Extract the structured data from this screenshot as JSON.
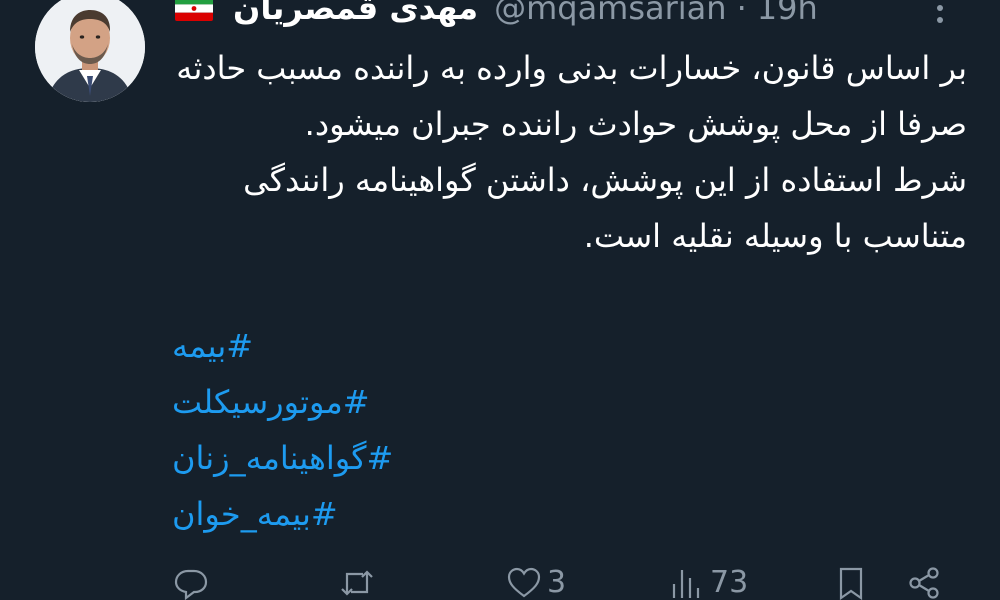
{
  "tweet": {
    "author": {
      "display_name": "مهدی قمصریان",
      "handle": "@mqamsarian",
      "separator": "·",
      "time": "19h",
      "flag_icon": "iran-flag-icon"
    },
    "body": [
      "بر اساس قانون، خسارات بدنی وارده به راننده مسبب حادثه صرفا از محل پوشش حوادث راننده جبران میشود.",
      "شرط استفاده از این پوشش، داشتن گواهینامه رانندگی متناسب با وسیله نقلیه است."
    ],
    "hashtags": [
      "#بیمه",
      "#موتورسیکلت",
      "#گواهینامه_زنان",
      "#بیمه_خوان"
    ],
    "actions": {
      "reply_icon": "reply-icon",
      "retweet_icon": "retweet-icon",
      "like_icon": "heart-icon",
      "like_count": "3",
      "views_icon": "views-icon",
      "view_count": "73",
      "bookmark_icon": "bookmark-icon",
      "share_icon": "share-icon"
    }
  }
}
